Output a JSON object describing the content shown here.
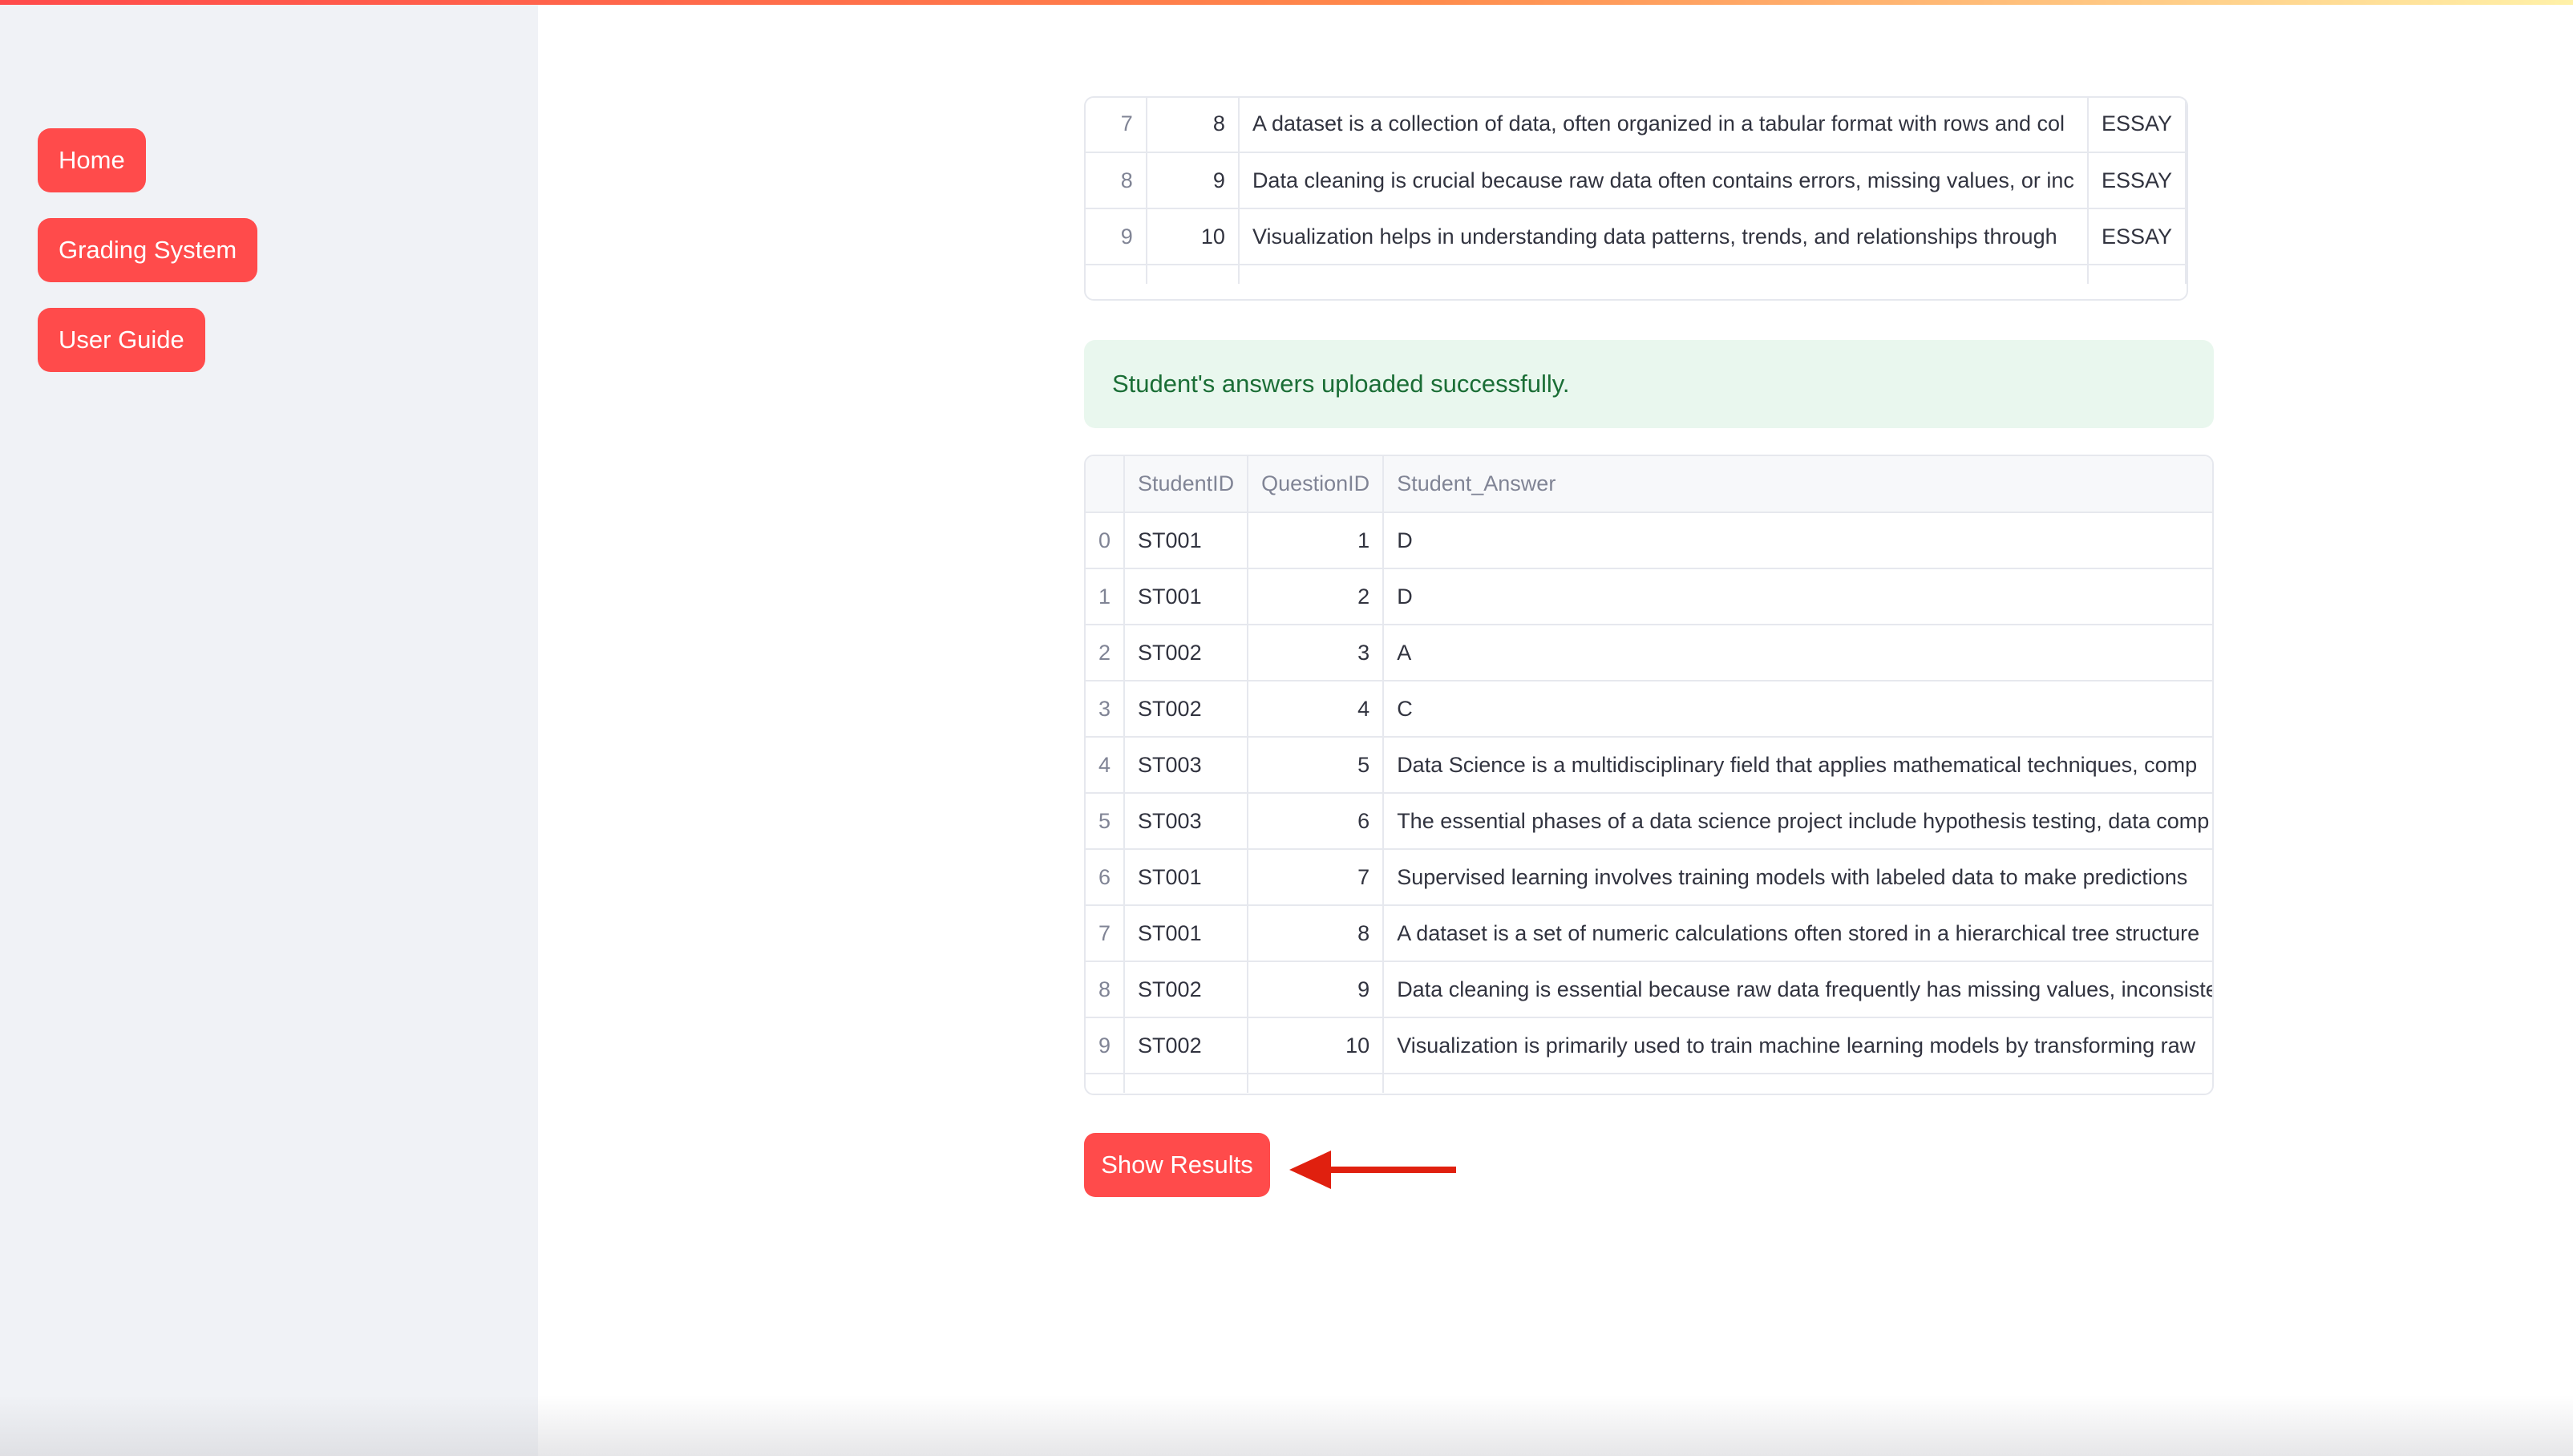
{
  "sidebar": {
    "items": [
      {
        "label": "Home"
      },
      {
        "label": "Grading System"
      },
      {
        "label": "User Guide"
      }
    ]
  },
  "questions_table": {
    "rows": [
      {
        "index": "7",
        "id": "8",
        "text": "A dataset is a collection of data, often organized in a tabular format with rows and col",
        "type": "ESSAY"
      },
      {
        "index": "8",
        "id": "9",
        "text": "Data cleaning is crucial because raw data often contains errors, missing values, or inc",
        "type": "ESSAY"
      },
      {
        "index": "9",
        "id": "10",
        "text": "Visualization helps in understanding data patterns, trends, and relationships through",
        "type": "ESSAY"
      }
    ]
  },
  "success_message": "Student's answers uploaded successfully.",
  "answers_table": {
    "columns": [
      "",
      "StudentID",
      "QuestionID",
      "Student_Answer"
    ],
    "rows": [
      {
        "index": "0",
        "student": "ST001",
        "question": "1",
        "answer": "D"
      },
      {
        "index": "1",
        "student": "ST001",
        "question": "2",
        "answer": "D"
      },
      {
        "index": "2",
        "student": "ST002",
        "question": "3",
        "answer": "A"
      },
      {
        "index": "3",
        "student": "ST002",
        "question": "4",
        "answer": "C"
      },
      {
        "index": "4",
        "student": "ST003",
        "question": "5",
        "answer": "Data Science is a multidisciplinary field that applies mathematical techniques, comp"
      },
      {
        "index": "5",
        "student": "ST003",
        "question": "6",
        "answer": "The essential phases of a data science project include hypothesis testing, data comp"
      },
      {
        "index": "6",
        "student": "ST001",
        "question": "7",
        "answer": "Supervised learning involves training models with labeled data to make predictions"
      },
      {
        "index": "7",
        "student": "ST001",
        "question": "8",
        "answer": "A dataset is a set of numeric calculations often stored in a hierarchical tree structure"
      },
      {
        "index": "8",
        "student": "ST002",
        "question": "9",
        "answer": "Data cleaning is essential because raw data frequently has missing values, inconsiste"
      },
      {
        "index": "9",
        "student": "ST002",
        "question": "10",
        "answer": "Visualization is primarily used to train machine learning models by transforming raw"
      }
    ]
  },
  "show_results_label": "Show Results",
  "colors": {
    "accent": "#ff4b4b",
    "sidebar_bg": "#f0f2f6",
    "success_bg": "#e9f7ee",
    "success_text": "#1b6e36",
    "arrow": "#e0200f"
  }
}
